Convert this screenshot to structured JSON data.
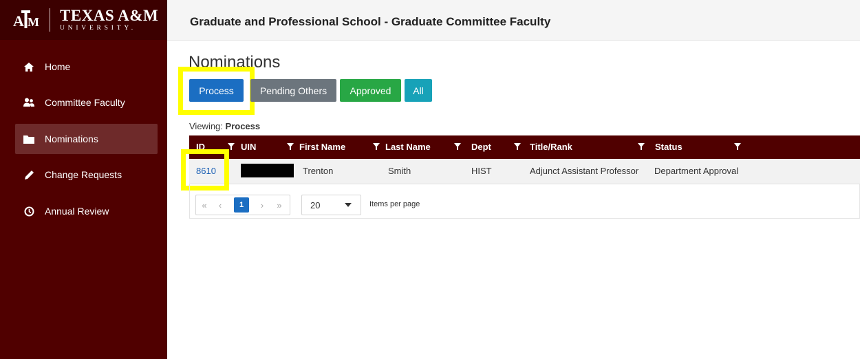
{
  "brand": {
    "logo_mark": "ATM",
    "name": "TEXAS A&M",
    "sub": "UNIVERSITY."
  },
  "header": {
    "title": "Graduate and Professional School - Graduate Committee Faculty"
  },
  "sidebar": {
    "items": [
      {
        "label": "Home",
        "icon": "home-icon"
      },
      {
        "label": "Committee Faculty",
        "icon": "users-icon"
      },
      {
        "label": "Nominations",
        "icon": "folder-icon",
        "active": true
      },
      {
        "label": "Change Requests",
        "icon": "pencil-icon"
      },
      {
        "label": "Annual Review",
        "icon": "clock-icon"
      }
    ]
  },
  "main": {
    "title": "Nominations",
    "filters": [
      {
        "label": "Process",
        "color": "#1b6ec2"
      },
      {
        "label": "Pending Others",
        "color": "#6c757d"
      },
      {
        "label": "Approved",
        "color": "#28a745"
      },
      {
        "label": "All",
        "color": "#17a2b8"
      }
    ],
    "viewing_prefix": "Viewing:",
    "viewing_value": "Process"
  },
  "table": {
    "columns": [
      "ID",
      "UIN",
      "First Name",
      "Last Name",
      "Dept",
      "Title/Rank",
      "Status"
    ],
    "rows": [
      {
        "id": "8610",
        "uin": "",
        "first_name": "Trenton",
        "last_name": "Smith",
        "dept": "HIST",
        "title_rank": "Adjunct Assistant Professor",
        "status": "Department Approval"
      }
    ]
  },
  "pager": {
    "first": "«",
    "prev": "‹",
    "current_page": "1",
    "next": "›",
    "last": "»",
    "page_size": "20",
    "items_per_page_label": "Items per page"
  },
  "colors": {
    "maroon": "#500000",
    "highlight": "#ffff00",
    "link": "#1a5fb4"
  }
}
